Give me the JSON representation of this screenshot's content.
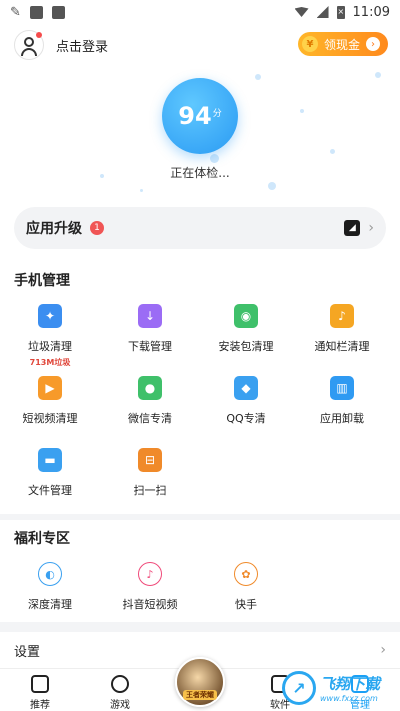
{
  "status_bar": {
    "time": "11:09"
  },
  "header": {
    "login_text": "点击登录",
    "cash_button": "领现金",
    "coin_glyph": "¥"
  },
  "score": {
    "value": "94",
    "unit": "分",
    "status": "正在体检..."
  },
  "upgrade": {
    "label": "应用升级",
    "count": "1"
  },
  "phone_manage": {
    "title": "手机管理",
    "items": [
      {
        "label": "垃圾清理",
        "sub": "713M垃圾",
        "icon": "broom-icon",
        "color": "#3b8ef0"
      },
      {
        "label": "下载管理",
        "icon": "download-icon",
        "color": "#9b6cf5"
      },
      {
        "label": "安装包清理",
        "icon": "android-icon",
        "color": "#3fc06a"
      },
      {
        "label": "通知栏清理",
        "icon": "bell-icon",
        "color": "#f5a623"
      },
      {
        "label": "短视频清理",
        "icon": "video-camera-icon",
        "color": "#f79a2a"
      },
      {
        "label": "微信专清",
        "icon": "wechat-icon",
        "color": "#3fc06a"
      },
      {
        "label": "QQ专清",
        "icon": "qq-penguin-icon",
        "color": "#3aa0f0"
      },
      {
        "label": "应用卸载",
        "icon": "trash-icon",
        "color": "#2f9af2"
      },
      {
        "label": "文件管理",
        "icon": "folder-icon",
        "color": "#3aa0f0"
      },
      {
        "label": "扫一扫",
        "icon": "scan-icon",
        "color": "#f08a2a"
      }
    ]
  },
  "welfare": {
    "title": "福利专区",
    "items": [
      {
        "label": "深度清理",
        "icon": "whale-icon",
        "color": "#3aa0f0"
      },
      {
        "label": "抖音短视频",
        "icon": "tiktok-icon",
        "color": "#f04a7a"
      },
      {
        "label": "快手",
        "icon": "kuaishou-icon",
        "color": "#f08a2a"
      }
    ]
  },
  "settings": {
    "label": "设置"
  },
  "bottom_nav": {
    "items": [
      {
        "label": "推荐",
        "icon": "recommend-icon"
      },
      {
        "label": "游戏",
        "icon": "game-icon"
      },
      {
        "label": "软件",
        "icon": "software-icon"
      },
      {
        "label": "管理",
        "icon": "manage-icon",
        "active": true
      }
    ],
    "center_badge": "王者荣耀"
  },
  "watermark": {
    "name": "飞翔下载",
    "url": "www.fxxz.com"
  }
}
